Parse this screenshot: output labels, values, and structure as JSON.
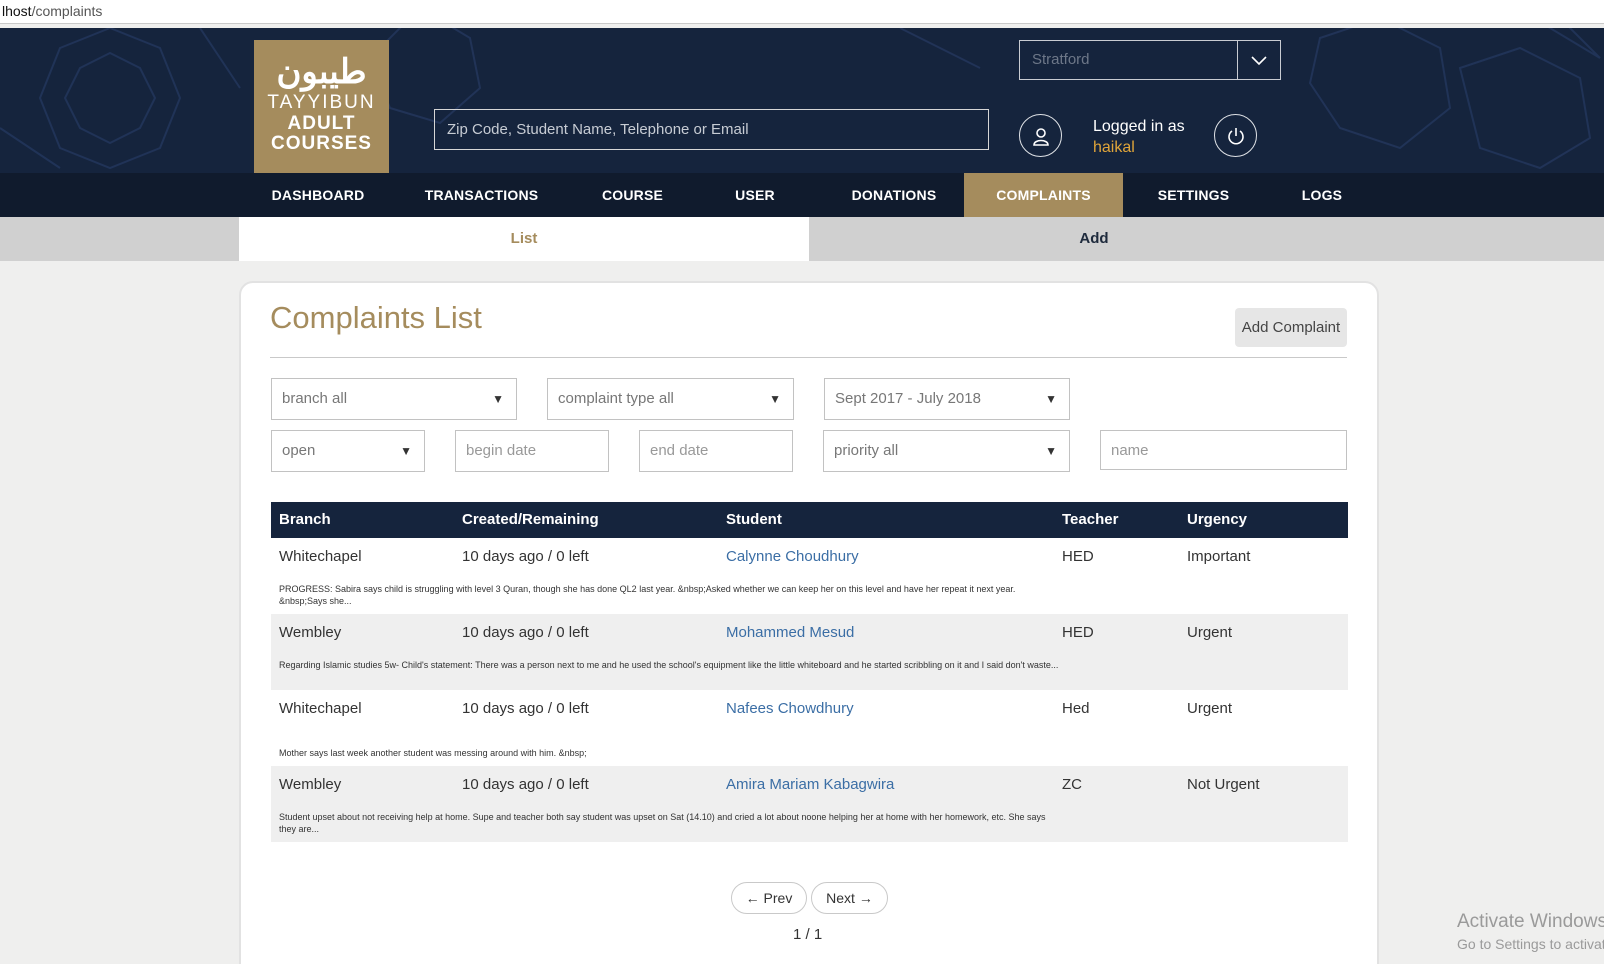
{
  "browser": {
    "url_host": "lhost",
    "url_path": "/complaints"
  },
  "header": {
    "logo": {
      "arabic": "طيبون",
      "line1": "TAYYIBUN",
      "line2": "ADULT",
      "line3": "COURSES"
    },
    "search_placeholder": "Zip Code, Student Name, Telephone or Email",
    "branch": "Stratford",
    "logged_in_label": "Logged in as",
    "username": "haikal"
  },
  "nav": {
    "items": [
      "DASHBOARD",
      "TRANSACTIONS",
      "COURSE",
      "USER",
      "DONATIONS",
      "COMPLAINTS",
      "SETTINGS",
      "LOGS"
    ],
    "active": "COMPLAINTS"
  },
  "subtabs": {
    "list": "List",
    "add": "Add"
  },
  "page": {
    "title": "Complaints List",
    "add_button": "Add Complaint"
  },
  "filters": {
    "branch": "branch all",
    "complaint_type": "complaint type all",
    "period": "Sept 2017 - July 2018",
    "status": "open",
    "begin_date_placeholder": "begin date",
    "end_date_placeholder": "end date",
    "priority": "priority all",
    "name_placeholder": "name"
  },
  "table": {
    "headers": [
      "Branch",
      "Created/Remaining",
      "Student",
      "Teacher",
      "Urgency"
    ],
    "rows": [
      {
        "branch": "Whitechapel",
        "created": "10 days ago / 0 left",
        "student": "Calynne Choudhury",
        "teacher": "HED",
        "urgency": "Important",
        "note": "PROGRESS: Sabira says child is struggling with level 3 Quran, though she has done QL2 last year. &nbsp;Asked whether we can keep her on this level and have her repeat it next year. &nbsp;Says she..."
      },
      {
        "branch": "Wembley",
        "created": "10 days ago / 0 left",
        "student": "Mohammed Mesud",
        "teacher": "HED",
        "urgency": "Urgent",
        "note": "Regarding Islamic studies 5w- Child's statement: There was a person next to me and he used the school's equipment like the little whiteboard and he started scribbling on it and I said don't waste..."
      },
      {
        "branch": "Whitechapel",
        "created": "10 days ago / 0 left",
        "student": "Nafees Chowdhury",
        "teacher": "Hed",
        "urgency": "Urgent",
        "note": "Mother says last week another student was messing around with him. &nbsp;"
      },
      {
        "branch": "Wembley",
        "created": "10 days ago / 0 left",
        "student": "Amira Mariam Kabagwira",
        "teacher": "ZC",
        "urgency": "Not Urgent",
        "note": "Student upset about not receiving help at home. Supe and teacher both say student was upset on Sat (14.10) and cried a lot about noone helping her at home with her homework, etc. She says they are..."
      }
    ]
  },
  "pagination": {
    "prev": "← Prev",
    "next": "Next →",
    "page": "1 / 1"
  },
  "watermark": {
    "line1": "Activate Windows",
    "line2": "Go to Settings to activate Windows."
  }
}
